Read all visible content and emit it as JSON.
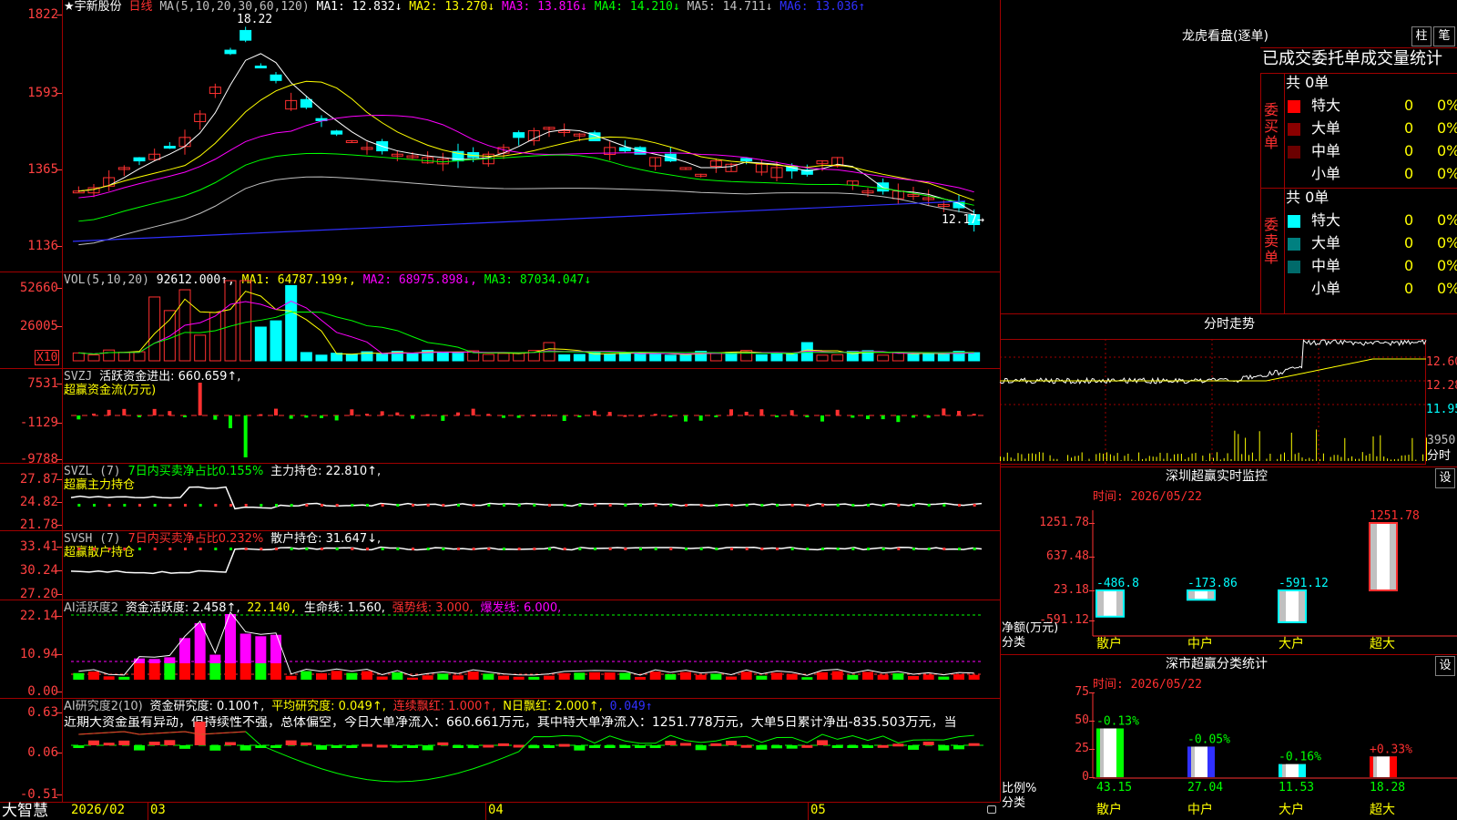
{
  "main": {
    "title": "★宇新股份",
    "period": "日线",
    "ma_params": "MA(5,10,20,30,60,120)",
    "ma": [
      {
        "label": "MA1: 12.832↓",
        "color": "#ffffff"
      },
      {
        "label": "MA2: 13.270↓",
        "color": "#ffff00"
      },
      {
        "label": "MA3: 13.816↓",
        "color": "#ff00ff"
      },
      {
        "label": "MA4: 14.210↓",
        "color": "#00ff00"
      },
      {
        "label": "MA5: 14.711↓",
        "color": "#c0c0c0"
      },
      {
        "label": "MA6: 13.036↑",
        "color": "#3030ff"
      }
    ],
    "y_ticks": [
      "1822",
      "1593",
      "1365",
      "1136"
    ],
    "high_marker": "18.22",
    "low_marker": "12.17→"
  },
  "vol": {
    "title": "VOL(5,10,20)",
    "value": "92612.000↑,",
    "ma1": "MA1: 64787.199↑,",
    "ma2": "MA2: 68975.898↓,",
    "ma3": "MA3: 87034.047↓",
    "y_ticks": [
      "52660",
      "26005"
    ],
    "unit": "X10"
  },
  "svzj": {
    "title": "SVZJ",
    "value": "活跃资金进出: 660.659↑,",
    "subtitle": "超赢资金流(万元)",
    "y_ticks": [
      "7531",
      "-1129",
      "-9788"
    ]
  },
  "svzl": {
    "title": "SVZL (7)",
    "ratio": "7日内买卖净占比0.155%",
    "value": "主力持仓: 22.810↑,",
    "subtitle": "超赢主力持仓",
    "y_ticks": [
      "27.87",
      "24.82",
      "21.78"
    ]
  },
  "svsh": {
    "title": "SVSH (7)",
    "ratio": "7日内买卖净占比0.232%",
    "value": "散户持仓: 31.647↓,",
    "subtitle": "超赢散户持仓",
    "y_ticks": [
      "33.41",
      "30.24",
      "27.20"
    ]
  },
  "ai_active": {
    "title": "AI活跃度2",
    "value1": "资金活跃度: 2.458↑,",
    "value2": "22.140,",
    "value3": "生命线: 1.560,",
    "value4": "强势线: 3.000,",
    "value5": "爆发线: 6.000,",
    "y_ticks": [
      "22.14",
      "10.94",
      "0.00"
    ]
  },
  "ai_research": {
    "title": "AI研究度2(10)",
    "value1": "资金研究度: 0.100↑,",
    "value2": "平均研究度: 0.049↑,",
    "value3": "连续飘红: 1.000↑,",
    "value4": "N日飘红: 2.000↑,",
    "value5": "0.049↑",
    "comment": "近期大资金虽有异动，但持续性不强，总体偏空，今日大单净流入：660.661万元，其中特大单净流入：1251.778万元，大单5日累计净出-835.503万元，当",
    "y_ticks": [
      "0.63",
      "0.06",
      "-0.51"
    ]
  },
  "bottom_bar": {
    "brand": "大智慧",
    "dates": [
      "2026/02",
      "03",
      "04",
      "05"
    ]
  },
  "dragon": {
    "title": "龙虎看盘(逐单)",
    "btn1": "柱",
    "btn2": "笔",
    "header": "已成交委托单成交量统计",
    "buy_label": "委买单",
    "sell_label": "委卖单",
    "buy_total": "共 0单",
    "sell_total": "共 0单",
    "buy_rows": [
      {
        "name": "特大",
        "count": "0",
        "pct": "0%",
        "color": "#ff0000"
      },
      {
        "name": "大单",
        "count": "0",
        "pct": "0%",
        "color": "#8b0000"
      },
      {
        "name": "中单",
        "count": "0",
        "pct": "0%",
        "color": "#6b0000"
      },
      {
        "name": "小单",
        "count": "0",
        "pct": "0%",
        "color": "#000000"
      }
    ],
    "sell_rows": [
      {
        "name": "特大",
        "count": "0",
        "pct": "0%",
        "color": "#00ffff"
      },
      {
        "name": "大单",
        "count": "0",
        "pct": "0%",
        "color": "#008080"
      },
      {
        "name": "中单",
        "count": "0",
        "pct": "0%",
        "color": "#006a6a"
      },
      {
        "name": "小单",
        "count": "0",
        "pct": "0%",
        "color": "#000000"
      }
    ]
  },
  "intraday": {
    "title": "分时走势",
    "y_ticks": [
      "12.60",
      "12.28",
      "11.95"
    ],
    "vol_tick": "3950",
    "vol_label": "分时"
  },
  "realtime": {
    "title": "深圳超赢实时监控",
    "btn": "设",
    "time": "时间: 2026/05/22",
    "y_ticks": [
      "1251.78",
      "637.48",
      "23.18",
      "-591.12"
    ],
    "y_label": "净额(万元)",
    "x_label": "分类",
    "categories": [
      "散户",
      "中户",
      "大户",
      "超大"
    ],
    "values": [
      -486.8,
      -173.86,
      -591.12,
      1251.78
    ],
    "value_labels": [
      "-486.8",
      "-173.86",
      "-591.12",
      "1251.78"
    ]
  },
  "classify": {
    "title": "深市超赢分类统计",
    "btn": "设",
    "time": "时间: 2026/05/22",
    "y_ticks": [
      "75",
      "50",
      "25",
      "0"
    ],
    "y_label": "比例%",
    "x_label": "分类",
    "categories": [
      "散户",
      "中户",
      "大户",
      "超大"
    ],
    "values": [
      43.15,
      27.04,
      11.53,
      18.28
    ],
    "value_labels": [
      "43.15",
      "27.04",
      "11.53",
      "18.28"
    ],
    "change_labels": [
      "-0.13%",
      "-0.05%",
      "-0.16%",
      "+0.33%"
    ],
    "bar_colors": [
      "#00ff00",
      "#3030ff",
      "#00ffff",
      "#ff0000"
    ]
  }
}
